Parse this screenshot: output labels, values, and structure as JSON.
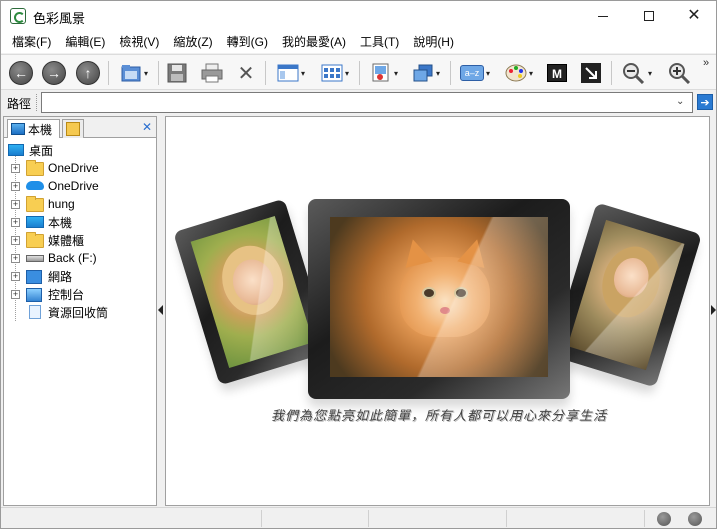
{
  "window": {
    "title": "色彩風景",
    "minimize_icon": "minimize-icon",
    "maximize_icon": "maximize-icon",
    "close_icon": "close-icon"
  },
  "menu": {
    "items": [
      {
        "label": "檔案(F)"
      },
      {
        "label": "編輯(E)"
      },
      {
        "label": "檢視(V)"
      },
      {
        "label": "縮放(Z)"
      },
      {
        "label": "轉到(G)"
      },
      {
        "label": "我的最愛(A)"
      },
      {
        "label": "工具(T)"
      },
      {
        "label": "說明(H)"
      }
    ]
  },
  "toolbar": {
    "back_icon": "back-arrow-icon",
    "forward_icon": "forward-arrow-icon",
    "up_icon": "up-arrow-icon",
    "overflow": "»",
    "dropdown_glyph": "▾",
    "back_glyph": "←",
    "forward_glyph": "→",
    "up_glyph": "↑",
    "delete_glyph": "✕",
    "sort_text": "a–z",
    "mobile_text": "M",
    "zoom_out_glyph": "−",
    "zoom_in_glyph": "+"
  },
  "pathbar": {
    "label": "路徑",
    "value": "",
    "dropdown_glyph": "⌄",
    "go_glyph": "➔"
  },
  "leftpanel": {
    "tab1_label": "本機",
    "close_glyph": "✕",
    "expand_glyph": "+",
    "tree": [
      {
        "label": "桌面",
        "icon": "desktop"
      },
      {
        "label": "OneDrive",
        "icon": "folder"
      },
      {
        "label": "OneDrive",
        "icon": "cloud"
      },
      {
        "label": "hung",
        "icon": "folder"
      },
      {
        "label": "本機",
        "icon": "pc"
      },
      {
        "label": "媒體櫃",
        "icon": "folder"
      },
      {
        "label": "Back (F:)",
        "icon": "drive"
      },
      {
        "label": "網路",
        "icon": "network"
      },
      {
        "label": "控制台",
        "icon": "control-panel"
      },
      {
        "label": "資源回收筒",
        "icon": "recycle-bin"
      }
    ]
  },
  "mainview": {
    "caption": "我們為您點亮如此簡單，所有人都可以用心來分享生活"
  },
  "statusbar": {
    "cells": [
      "",
      "",
      "",
      ""
    ]
  }
}
